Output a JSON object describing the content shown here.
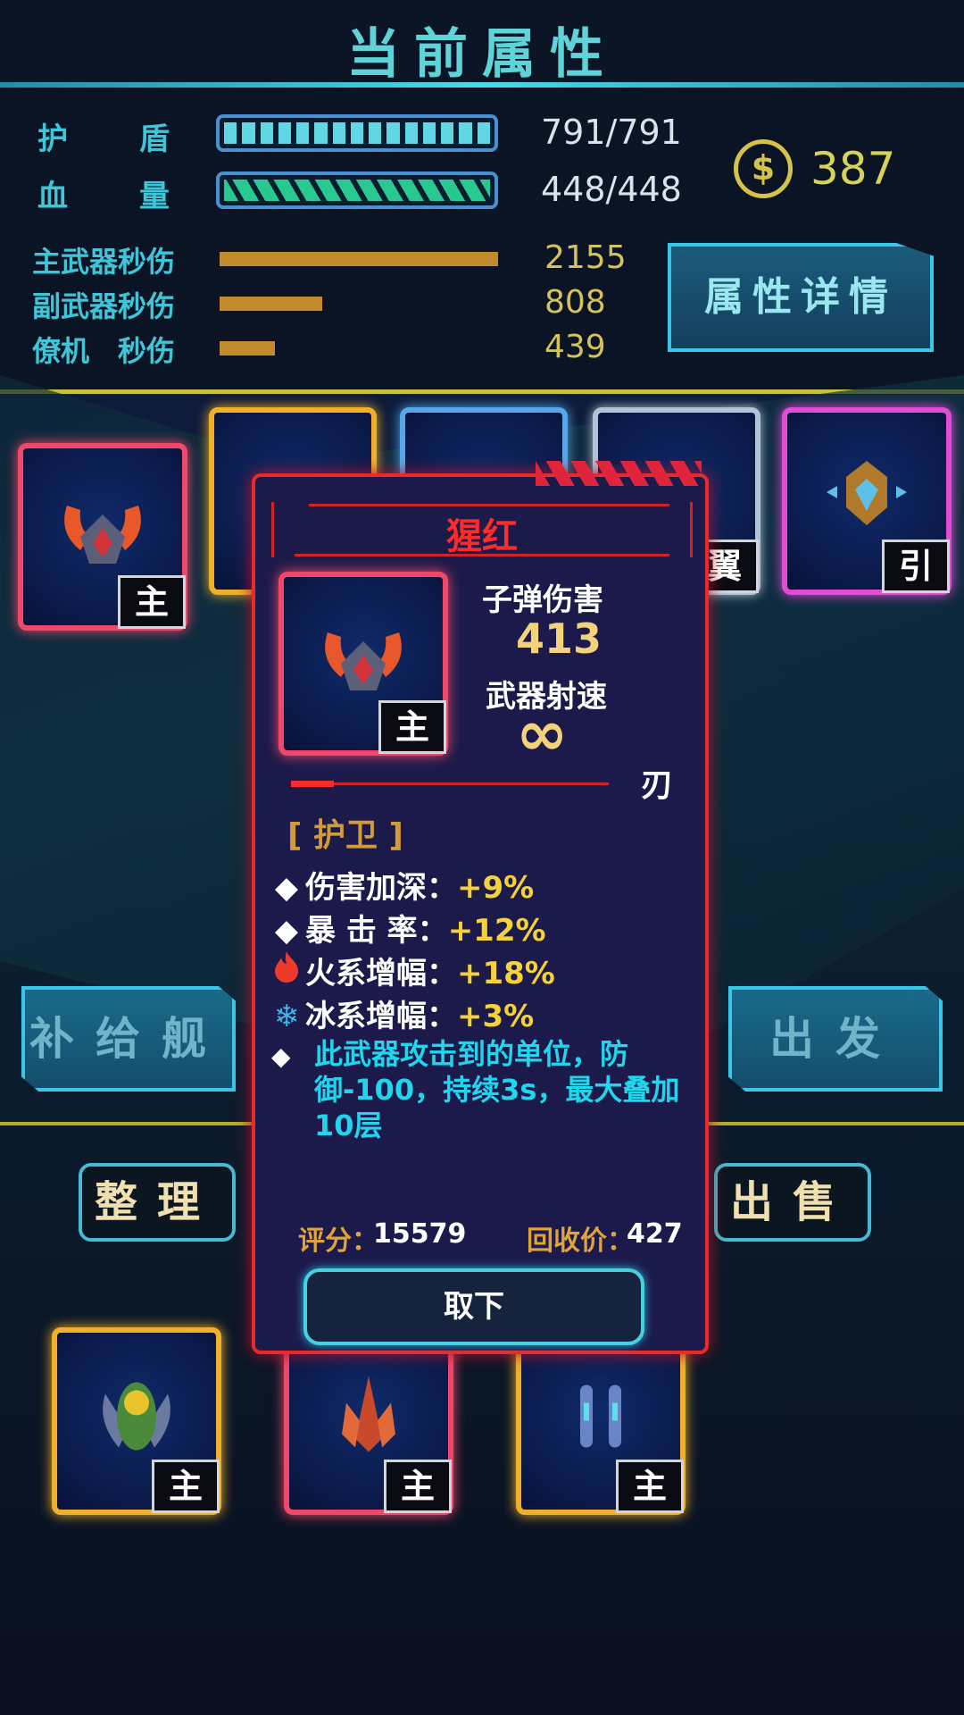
{
  "header": {
    "title": "当前属性"
  },
  "stats": {
    "shield": {
      "label1": "护",
      "label2": "盾",
      "value": "791/791",
      "fraction": 1.0
    },
    "hp": {
      "label1": "血",
      "label2": "量",
      "value": "448/448",
      "fraction": 1.0
    },
    "dps": [
      {
        "label": "主武器秒伤",
        "value": "2155",
        "fraction": 1.0
      },
      {
        "label": "副武器秒伤",
        "value": "808",
        "fraction": 0.37
      },
      {
        "label": "僚机　秒伤",
        "value": "439",
        "fraction": 0.2
      }
    ],
    "coins": "387",
    "coin_symbol": "$",
    "detail_button": "属性详情"
  },
  "slots": [
    {
      "tag": "主",
      "color": "red"
    },
    {
      "tag": "",
      "color": "gold"
    },
    {
      "tag": "",
      "color": "blue"
    },
    {
      "tag": "翼",
      "color": "silver"
    },
    {
      "tag": "引",
      "color": "pink"
    }
  ],
  "buttons": {
    "supply": "补给舰",
    "depart": "出发",
    "sort": "整理",
    "sell": "出售"
  },
  "inventory": [
    {
      "tag": "主",
      "color": "gold"
    },
    {
      "tag": "主",
      "color": "red"
    },
    {
      "tag": "主",
      "color": "gold"
    }
  ],
  "popup": {
    "title": "猩红",
    "card_tag": "主",
    "bullet_damage_label": "子弹伤害",
    "bullet_damage": "413",
    "fire_rate_label": "武器射速",
    "fire_rate": "∞",
    "blade": "刃",
    "category": "[ 护卫 ]",
    "attributes": [
      {
        "icon": "diamond-icon",
        "key": "伤害加深：",
        "value": "+9%"
      },
      {
        "icon": "diamond-icon",
        "key": "暴 击 率：",
        "value": "+12%"
      },
      {
        "icon": "fire-icon",
        "key": "火系增幅：",
        "value": "+18%"
      },
      {
        "icon": "snowflake-icon",
        "key": "冰系增幅：",
        "value": "+3%"
      }
    ],
    "description": "此武器攻击到的单位，防御-100，持续3s，最大叠加10层",
    "score_label": "评分：",
    "score": "15579",
    "recycle_label": "回收价：",
    "recycle": "427",
    "remove_button": "取下"
  },
  "colors": {
    "accent_cyan": "#3ec6d8",
    "gold": "#d7c25a",
    "popup_red": "#e62b2b",
    "value_yellow": "#f5d23a",
    "desc_cyan": "#22d5ee"
  }
}
